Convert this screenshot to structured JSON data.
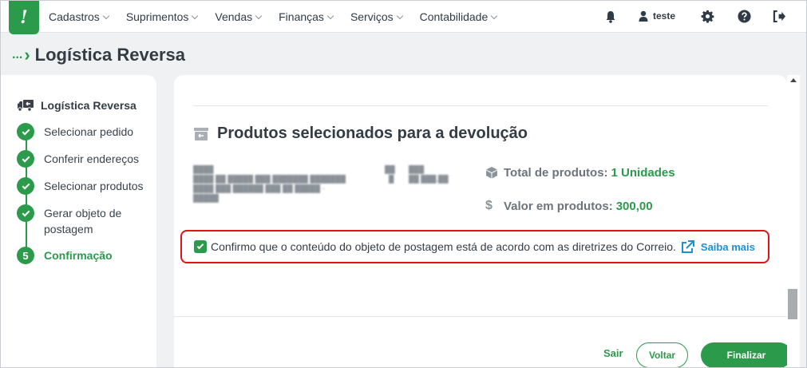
{
  "nav": {
    "logo": "!",
    "menu": [
      {
        "label": "Cadastros"
      },
      {
        "label": "Suprimentos"
      },
      {
        "label": "Vendas"
      },
      {
        "label": "Finanças"
      },
      {
        "label": "Serviços"
      },
      {
        "label": "Contabilidade"
      }
    ],
    "user": "teste",
    "icons": [
      "bell-icon",
      "user-icon",
      "gear-icon",
      "help-icon",
      "logout-icon"
    ]
  },
  "breadcrumb": {
    "ellipsis": "...",
    "separator": "›",
    "title": "Logística Reversa"
  },
  "sidebar": {
    "title": "Logística Reversa",
    "steps": [
      {
        "label": "Selecionar pedido",
        "status": "done"
      },
      {
        "label": "Conferir endereços",
        "status": "done"
      },
      {
        "label": "Selecionar produtos",
        "status": "done"
      },
      {
        "label": "Gerar objeto de postagem",
        "status": "done"
      },
      {
        "label": "Confirmação",
        "status": "active",
        "number": "5"
      }
    ]
  },
  "main": {
    "section_title": "Produtos selecionados para a devolução",
    "summary": {
      "total_label": "Total de produtos:",
      "total_value": "1 Unidades",
      "valor_label": "Valor em produtos:",
      "valor_value": "300,00"
    },
    "confirm": {
      "text": "Confirmo que o conteúdo do objeto de postagem está de acordo com as diretrizes do Correio.",
      "checked": true,
      "link": "Saiba mais"
    }
  },
  "footer": {
    "sair": "Sair",
    "voltar": "Voltar",
    "finalizar": "Finalizar"
  },
  "colors": {
    "brand": "#2c9a4b",
    "link": "#1f8fd1",
    "highlight": "#e01414"
  }
}
